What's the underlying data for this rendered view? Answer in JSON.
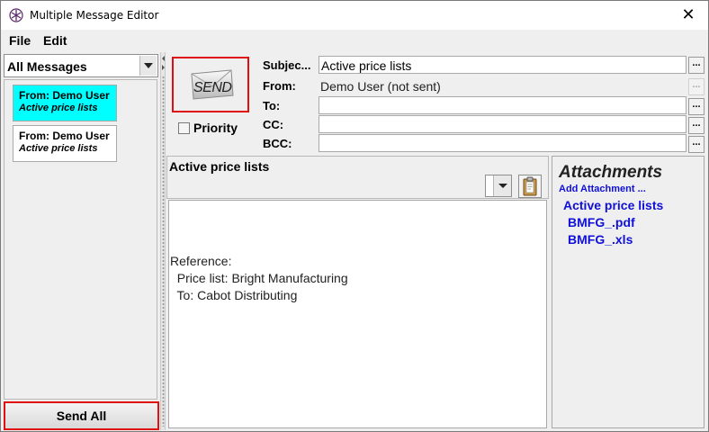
{
  "window": {
    "title": "Multiple Message Editor",
    "close_glyph": "✕"
  },
  "menu": {
    "items": [
      "File",
      "Edit"
    ]
  },
  "left_panel": {
    "filter_selected": "All Messages",
    "messages": [
      {
        "from": "From: Demo User",
        "subject": "Active price lists",
        "selected": true
      },
      {
        "from": "From: Demo User",
        "subject": "Active price lists",
        "selected": false
      }
    ],
    "send_all_label": "Send All"
  },
  "compose": {
    "send_label": "SEND",
    "priority_label": "Priority",
    "priority_checked": false,
    "fields": {
      "subject_label": "Subjec...",
      "subject_value": "Active price lists",
      "from_label": "From:",
      "from_value": "Demo User (not sent)",
      "to_label": "To:",
      "to_value": "",
      "cc_label": "CC:",
      "cc_value": "",
      "bcc_label": "BCC:",
      "bcc_value": ""
    },
    "ellipsis_label": "..."
  },
  "body": {
    "subject": "Active price lists",
    "lines": [
      "Reference:",
      "  Price list: Bright Manufacturing",
      "  To: Cabot Distributing"
    ]
  },
  "attachments": {
    "title": "Attachments",
    "add_label": "Add Attachment ...",
    "group": "Active price lists",
    "files": [
      "BMFG_.pdf",
      "BMFG_.xls"
    ]
  },
  "colors": {
    "selected_message": "#00ffff",
    "highlight_border": "#e01010",
    "link_blue": "#1010d8"
  }
}
